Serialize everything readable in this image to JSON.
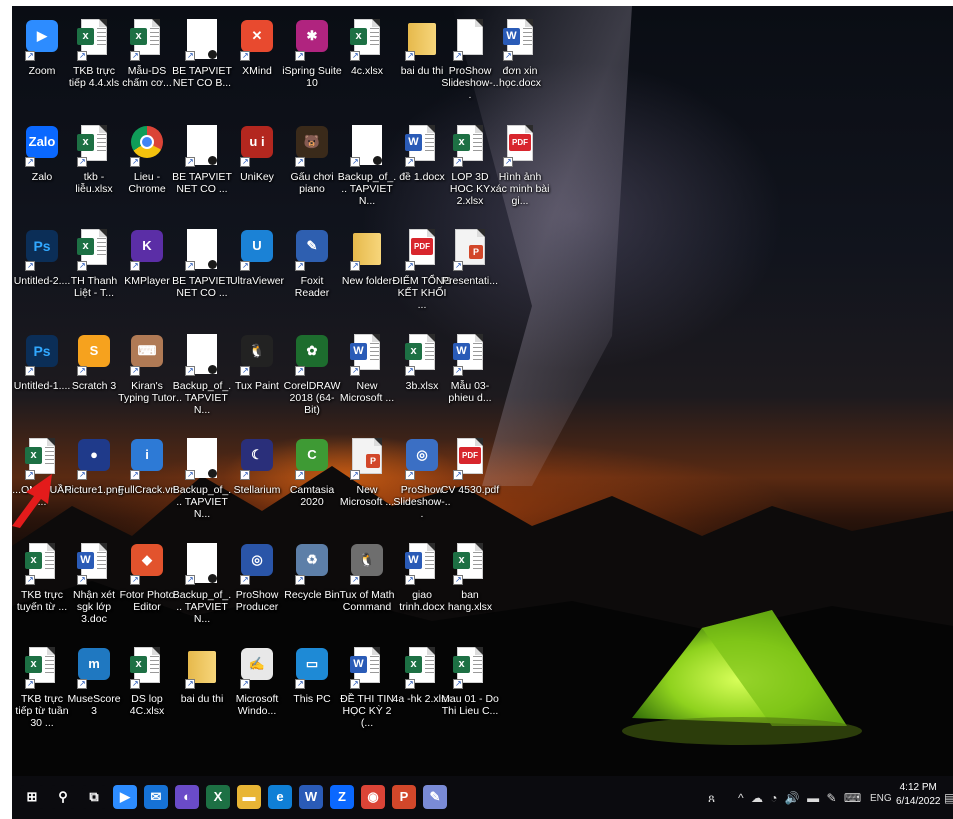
{
  "desktop": {
    "icons": [
      {
        "label": "Zoom",
        "kind": "app",
        "glyph": "▶",
        "color": "#2d8cff",
        "col": 0,
        "row": 0
      },
      {
        "label": "TKB trực tiếp 4.4.xls",
        "kind": "xls",
        "col": 1,
        "row": 0
      },
      {
        "label": "Mẫu-DS chấm cơ...",
        "kind": "xls",
        "col": 2,
        "row": 0
      },
      {
        "label": "BE TAPVIET NET CO B...",
        "kind": "blank",
        "col": 3,
        "row": 0
      },
      {
        "label": "XMind",
        "kind": "app",
        "glyph": "✕",
        "color": "#e84a2f",
        "col": 4,
        "row": 0
      },
      {
        "label": "iSpring Suite 10",
        "kind": "app",
        "glyph": "✱",
        "color": "#b0247f",
        "col": 5,
        "row": 0
      },
      {
        "label": "4c.xlsx",
        "kind": "xls",
        "col": 6,
        "row": 0
      },
      {
        "label": "bai du thi",
        "kind": "folder",
        "col": 7,
        "row": 0
      },
      {
        "label": "ProShow Slideshow-...",
        "kind": "plain",
        "col": 8,
        "row": 0
      },
      {
        "label": "đơn xin học.docx",
        "kind": "doc",
        "col": 9,
        "row": 0
      },
      {
        "label": "Zalo",
        "kind": "app",
        "glyph": "Zalo",
        "color": "#0a68ff",
        "col": 0,
        "row": 1
      },
      {
        "label": "tkb - liễu.xlsx",
        "kind": "xls",
        "col": 1,
        "row": 1
      },
      {
        "label": "Lieu - Chrome",
        "kind": "chrome",
        "col": 2,
        "row": 1
      },
      {
        "label": "BE TAPVIET NET CO ...",
        "kind": "blank",
        "col": 3,
        "row": 1
      },
      {
        "label": "UniKey",
        "kind": "app",
        "glyph": "u i",
        "color": "#b3271f",
        "col": 4,
        "row": 1
      },
      {
        "label": "Gấu chơi piano",
        "kind": "app",
        "glyph": "🐻",
        "color": "#3a2a1a",
        "col": 5,
        "row": 1
      },
      {
        "label": "Backup_of_... TAPVIET N...",
        "kind": "blank",
        "col": 6,
        "row": 1
      },
      {
        "label": "đề 1.docx",
        "kind": "doc",
        "col": 7,
        "row": 1
      },
      {
        "label": "LOP 3D HOC KY 2.xlsx",
        "kind": "xls",
        "col": 8,
        "row": 1
      },
      {
        "label": "Hình ảnh xác minh bài gi...",
        "kind": "pdf",
        "col": 9,
        "row": 1
      },
      {
        "label": "Untitled-2....",
        "kind": "psd",
        "col": 0,
        "row": 2
      },
      {
        "label": "TH Thanh Liệt - T...",
        "kind": "xls",
        "col": 1,
        "row": 2
      },
      {
        "label": "KMPlayer",
        "kind": "app",
        "glyph": "K",
        "color": "#5b2ea6",
        "col": 2,
        "row": 2
      },
      {
        "label": "BE TAPVIET NET CO ...",
        "kind": "blank",
        "col": 3,
        "row": 2
      },
      {
        "label": "UltraViewer",
        "kind": "app",
        "glyph": "U",
        "color": "#1b82d6",
        "col": 4,
        "row": 2
      },
      {
        "label": "Foxit Reader",
        "kind": "app",
        "glyph": "✎",
        "color": "#2e5fb0",
        "col": 5,
        "row": 2
      },
      {
        "label": "New folder",
        "kind": "folder",
        "col": 6,
        "row": 2
      },
      {
        "label": "ĐIỂM TỔNG KẾT KHỐI ...",
        "kind": "pdf",
        "col": 7,
        "row": 2
      },
      {
        "label": "Presentati...",
        "kind": "ppt",
        "col": 8,
        "row": 2
      },
      {
        "label": "Untitled-1....",
        "kind": "psd",
        "col": 0,
        "row": 3
      },
      {
        "label": "Scratch 3",
        "kind": "app",
        "glyph": "S",
        "color": "#f6a21e",
        "col": 1,
        "row": 3
      },
      {
        "label": "Kiran's Typing Tutor",
        "kind": "app",
        "glyph": "⌨",
        "color": "#b07a55",
        "col": 2,
        "row": 3
      },
      {
        "label": "Backup_of_... TAPVIET N...",
        "kind": "blank",
        "col": 3,
        "row": 3
      },
      {
        "label": "Tux Paint",
        "kind": "app",
        "glyph": "🐧",
        "color": "#222222",
        "col": 4,
        "row": 3
      },
      {
        "label": "CorelDRAW 2018 (64-Bit)",
        "kind": "app",
        "glyph": "✿",
        "color": "#1d6d2e",
        "col": 5,
        "row": 3
      },
      {
        "label": "New Microsoft ...",
        "kind": "doc",
        "col": 6,
        "row": 3
      },
      {
        "label": "3b.xlsx",
        "kind": "xls",
        "col": 7,
        "row": 3
      },
      {
        "label": "Mẫu 03-phieu d...",
        "kind": "doc",
        "col": 8,
        "row": 3
      },
      {
        "label": "...OM ...UẦN ...",
        "kind": "xls",
        "col": 0,
        "row": 4
      },
      {
        "label": "Picture1.png",
        "kind": "app",
        "glyph": "●",
        "color": "#1f3a8a",
        "col": 1,
        "row": 4
      },
      {
        "label": "FullCrack.vn",
        "kind": "app",
        "glyph": "i",
        "color": "#2d7ad6",
        "col": 2,
        "row": 4
      },
      {
        "label": "Backup_of_... TAPVIET N...",
        "kind": "blank",
        "col": 3,
        "row": 4
      },
      {
        "label": "Stellarium",
        "kind": "app",
        "glyph": "☾",
        "color": "#2a2f7a",
        "col": 4,
        "row": 4
      },
      {
        "label": "Camtasia 2020",
        "kind": "app",
        "glyph": "C",
        "color": "#3e9a34",
        "col": 5,
        "row": 4
      },
      {
        "label": "New Microsoft ...",
        "kind": "ppt",
        "col": 6,
        "row": 4
      },
      {
        "label": "ProShow Slideshow-...",
        "kind": "app",
        "glyph": "◎",
        "color": "#3b6fc4",
        "col": 7,
        "row": 4
      },
      {
        "label": "CV 4530.pdf",
        "kind": "pdf",
        "col": 8,
        "row": 4
      },
      {
        "label": "TKB trực tuyến từ ...",
        "kind": "xls",
        "col": 0,
        "row": 5
      },
      {
        "label": "Nhận xét sgk lớp 3.doc",
        "kind": "doc",
        "col": 1,
        "row": 5
      },
      {
        "label": "Fotor Photo Editor",
        "kind": "app",
        "glyph": "◆",
        "color": "#e2532d",
        "col": 2,
        "row": 5
      },
      {
        "label": "Backup_of_... TAPVIET N...",
        "kind": "blank",
        "col": 3,
        "row": 5
      },
      {
        "label": "ProShow Producer",
        "kind": "app",
        "glyph": "◎",
        "color": "#2a55a8",
        "col": 4,
        "row": 5
      },
      {
        "label": "Recycle Bin",
        "kind": "app",
        "glyph": "♻",
        "color": "#5d7fa8",
        "col": 5,
        "row": 5
      },
      {
        "label": "Tux of Math Command",
        "kind": "app",
        "glyph": "🐧",
        "color": "#6e6e6e",
        "col": 6,
        "row": 5
      },
      {
        "label": "giao trinh.docx",
        "kind": "doc",
        "col": 7,
        "row": 5
      },
      {
        "label": "ban hang.xlsx",
        "kind": "xls",
        "col": 8,
        "row": 5
      },
      {
        "label": "TKB trực tiếp từ tuần 30 ...",
        "kind": "xls",
        "col": 0,
        "row": 6
      },
      {
        "label": "MuseScore 3",
        "kind": "app",
        "glyph": "m",
        "color": "#1f78c1",
        "col": 1,
        "row": 6
      },
      {
        "label": "DS lop 4C.xlsx",
        "kind": "xls",
        "col": 2,
        "row": 6
      },
      {
        "label": "bai du thi",
        "kind": "folder",
        "col": 3,
        "row": 6
      },
      {
        "label": "Microsoft Windo...",
        "kind": "app",
        "glyph": "✍",
        "color": "#e8e8e8",
        "col": 4,
        "row": 6
      },
      {
        "label": "This PC",
        "kind": "app",
        "glyph": "▭",
        "color": "#1e8ad6",
        "col": 5,
        "row": 6
      },
      {
        "label": "ĐỀ THI TIN HỌC KỲ 2 (...",
        "kind": "doc",
        "col": 6,
        "row": 6
      },
      {
        "label": "4a -hk 2.xlsx",
        "kind": "xls",
        "col": 7,
        "row": 6
      },
      {
        "label": "Mau 01 - Do Thi Lieu C...",
        "kind": "xls",
        "col": 8,
        "row": 6
      }
    ]
  },
  "taskbar": {
    "apps": [
      {
        "name": "start-button",
        "glyph": "⊞",
        "color": "#0b0b0f"
      },
      {
        "name": "search-button",
        "glyph": "⚲",
        "color": "#0b0b0f"
      },
      {
        "name": "task-view-button",
        "glyph": "⧉",
        "color": "#0b0b0f"
      },
      {
        "name": "zoom-taskbar",
        "glyph": "▶",
        "color": "#2d8cff"
      },
      {
        "name": "mail-taskbar",
        "glyph": "✉",
        "color": "#1672d6"
      },
      {
        "name": "fotor-taskbar",
        "glyph": "◐",
        "color": "#6a4bc8"
      },
      {
        "name": "excel-taskbar",
        "glyph": "X",
        "color": "#1d7044"
      },
      {
        "name": "file-explorer-taskbar",
        "glyph": "▬",
        "color": "#e8b535"
      },
      {
        "name": "edge-taskbar",
        "glyph": "e",
        "color": "#0f7fd6"
      },
      {
        "name": "word-taskbar",
        "glyph": "W",
        "color": "#2a5bb7"
      },
      {
        "name": "zalo-taskbar",
        "glyph": "Z",
        "color": "#0a68ff"
      },
      {
        "name": "chrome-taskbar",
        "glyph": "◉",
        "color": "#db4437"
      },
      {
        "name": "powerpoint-taskbar",
        "glyph": "P",
        "color": "#d2472a"
      },
      {
        "name": "paint-taskbar",
        "glyph": "✎",
        "color": "#7a8bd6"
      }
    ],
    "tray": {
      "people": "ጸ",
      "icons": "^ ☁ ◔ 🔊 ▬ ✎ ⌨",
      "language": "ENG",
      "time": "4:12 PM",
      "date": "6/14/2022",
      "notifications": "▤"
    }
  }
}
